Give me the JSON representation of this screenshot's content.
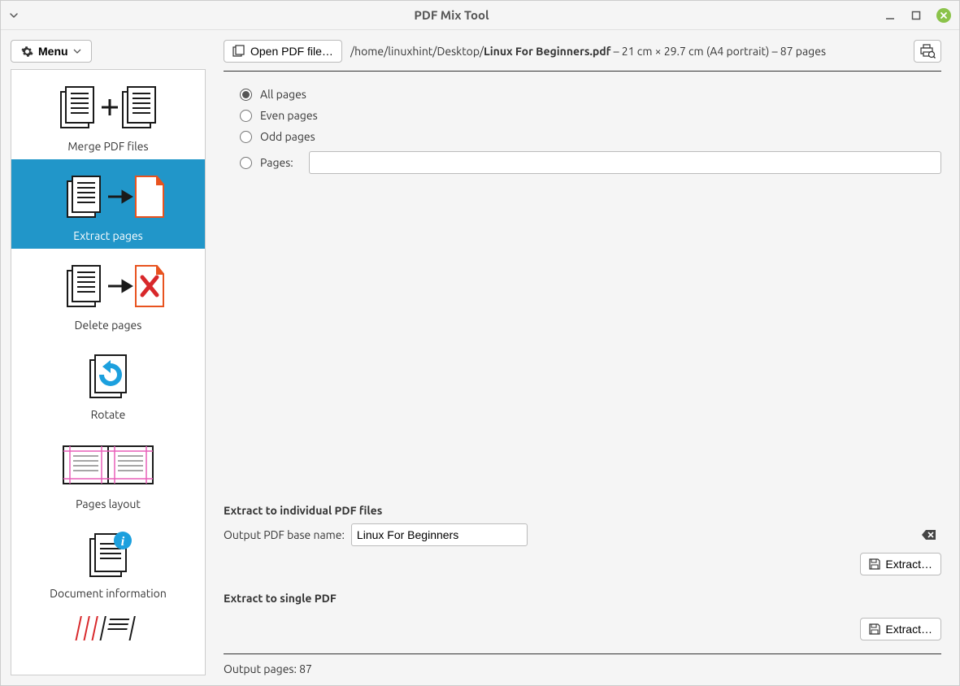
{
  "window": {
    "title": "PDF Mix Tool"
  },
  "menu": {
    "label": "Menu"
  },
  "tools": {
    "merge": "Merge PDF files",
    "extract": "Extract pages",
    "delete": "Delete pages",
    "rotate": "Rotate",
    "layout": "Pages layout",
    "docinfo": "Document information"
  },
  "toolbar": {
    "open_label": "Open PDF file…",
    "path_prefix": "/home/linuxhint/Desktop/",
    "path_filename": "Linux For Beginners.pdf",
    "path_suffix": " – 21 cm × 29.7 cm (A4 portrait) – 87 pages"
  },
  "radios": {
    "all": "All pages",
    "even": "Even pages",
    "odd": "Odd pages",
    "pages": "Pages:"
  },
  "extract_individual": {
    "heading": "Extract to individual PDF files",
    "base_name_label": "Output PDF base name:",
    "base_name_value": "Linux For Beginners",
    "button": "Extract…"
  },
  "extract_single": {
    "heading": "Extract to single PDF",
    "button": "Extract…"
  },
  "footer": {
    "output_pages": "Output pages: 87"
  }
}
